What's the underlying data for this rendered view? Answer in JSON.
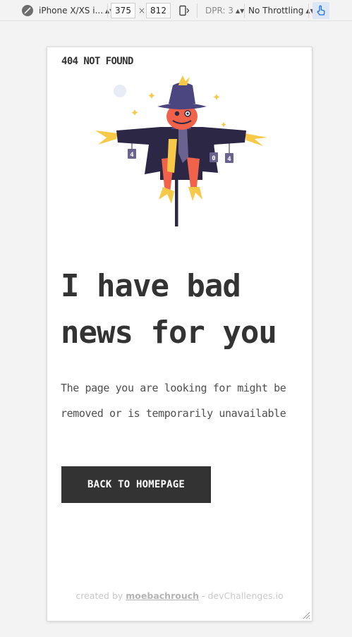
{
  "toolbar": {
    "device": "iPhone X/XS i...",
    "width": "375",
    "times": "×",
    "height": "812",
    "dpr": "DPR: 3",
    "throttling": "No Throttling"
  },
  "page": {
    "brand": "404 NOT FOUND",
    "headline": "I have bad news for you",
    "description": "The page you are looking for might be removed or is temporarily unavailable",
    "cta": "BACK TO HOMEPAGE",
    "footer_prefix": "created by",
    "footer_author": "moebachrouch",
    "footer_suffix": "- devChallenges.io",
    "sign_digits": [
      "4",
      "0",
      "4"
    ]
  },
  "colors": {
    "dark": "#333333",
    "text": "#4f4f4f",
    "footer": "#c9c9c9",
    "scarecrow_coat": "#2b2745",
    "scarecrow_head": "#f0624a",
    "scarecrow_hat": "#4b4680",
    "straw": "#f7c948"
  }
}
